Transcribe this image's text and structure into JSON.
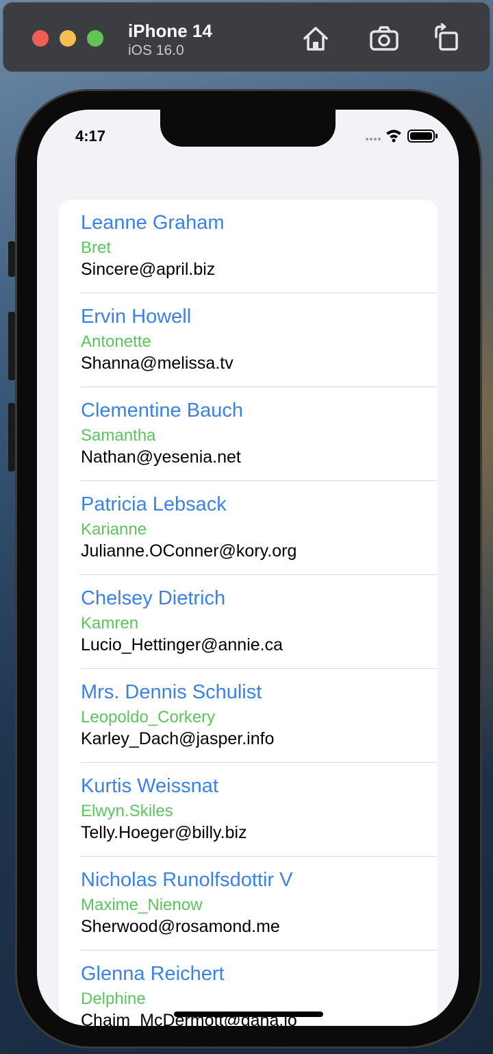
{
  "simulator": {
    "device_name": "iPhone 14",
    "os_version": "iOS 16.0"
  },
  "status_bar": {
    "time": "4:17"
  },
  "users": [
    {
      "name": "Leanne Graham",
      "username": "Bret",
      "email": "Sincere@april.biz"
    },
    {
      "name": "Ervin Howell",
      "username": "Antonette",
      "email": "Shanna@melissa.tv"
    },
    {
      "name": "Clementine Bauch",
      "username": "Samantha",
      "email": "Nathan@yesenia.net"
    },
    {
      "name": "Patricia Lebsack",
      "username": "Karianne",
      "email": "Julianne.OConner@kory.org"
    },
    {
      "name": "Chelsey Dietrich",
      "username": "Kamren",
      "email": "Lucio_Hettinger@annie.ca"
    },
    {
      "name": "Mrs. Dennis Schulist",
      "username": "Leopoldo_Corkery",
      "email": "Karley_Dach@jasper.info"
    },
    {
      "name": "Kurtis Weissnat",
      "username": "Elwyn.Skiles",
      "email": "Telly.Hoeger@billy.biz"
    },
    {
      "name": "Nicholas Runolfsdottir V",
      "username": "Maxime_Nienow",
      "email": "Sherwood@rosamond.me"
    },
    {
      "name": "Glenna Reichert",
      "username": "Delphine",
      "email": "Chaim_McDermott@dana.io"
    }
  ],
  "colors": {
    "name": "#3a82e6",
    "username": "#5cc45d",
    "email": "#000000"
  }
}
